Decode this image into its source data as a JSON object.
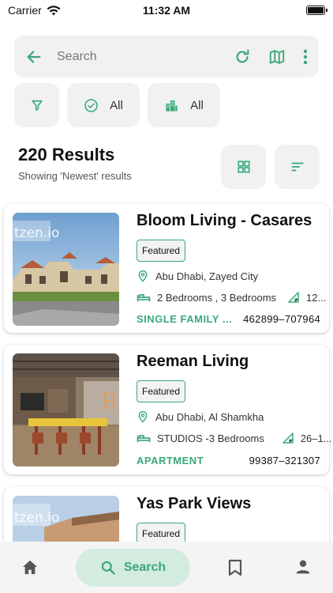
{
  "status": {
    "carrier": "Carrier",
    "time": "11:32 AM"
  },
  "search": {
    "placeholder": "Search"
  },
  "filters": {
    "status_label": "All",
    "type_label": "All"
  },
  "results": {
    "count_text": "220 Results",
    "subtitle": "Showing 'Newest' results"
  },
  "listings": [
    {
      "title": "Bloom Living - Casares",
      "badge": "Featured",
      "location": "Abu Dhabi, Zayed City",
      "bedrooms": "2 Bedrooms , 3 Bedrooms",
      "area": "12...",
      "type": "SINGLE FAMILY ...",
      "price": "462899–707964",
      "watermark": "tzen.io"
    },
    {
      "title": "Reeman Living",
      "badge": "Featured",
      "location": "Abu Dhabi, Al Shamkha",
      "bedrooms": "STUDIOS -3 Bedrooms",
      "area": "26–1...",
      "type": "APARTMENT",
      "price": "99387–321307",
      "watermark": ""
    },
    {
      "title": "Yas Park Views",
      "badge": "Featured",
      "watermark": "tzen.io"
    }
  ],
  "nav": {
    "search_label": "Search"
  },
  "colors": {
    "accent": "#3aa979",
    "chip_bg": "#f1f1f1",
    "nav_active_bg": "#d4ebdf"
  }
}
